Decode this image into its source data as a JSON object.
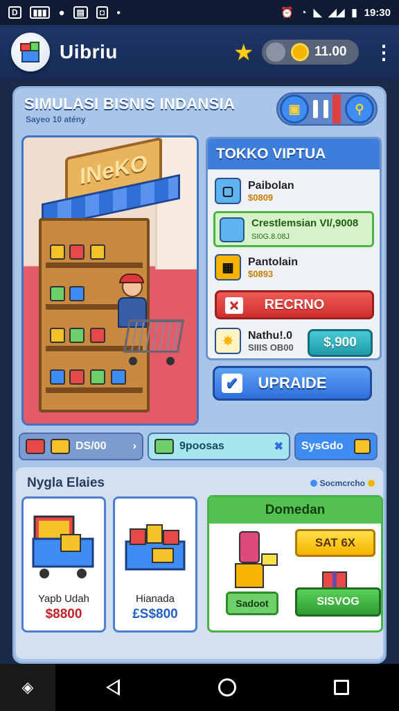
{
  "status_bar": {
    "time": "19:30"
  },
  "app_bar": {
    "title": "Uibriu",
    "coins": "11.00"
  },
  "game": {
    "title": "SIMULASI BISNIS INDANSIA",
    "subtitle": "Sayeo 10 atény",
    "shop_sign": "INeKO"
  },
  "store_panel": {
    "title": "TOKKO VIPTUA",
    "items": [
      {
        "name": "Paibolan",
        "price": "$0809"
      },
      {
        "name": "Crestlemsian",
        "extra": "VI/,9008",
        "sub": "SI0G.8.08J"
      },
      {
        "name": "Pantolain",
        "price": "$0893"
      }
    ],
    "red_button": "RECRNO",
    "nathul": {
      "name": "Nathu!.0",
      "sub": "SIIIS OB00",
      "button": "$,900"
    },
    "upgrade_button": "UPRAIDE"
  },
  "stats": {
    "left": "DS/00",
    "middle": "9poosas",
    "right": "SysGdo"
  },
  "section": {
    "title": "Nygla Elaies",
    "right_label": "Socmcrcho",
    "cards": [
      {
        "name": "Yapb Udah",
        "price": "$8800",
        "color": "#c0202a"
      },
      {
        "name": "Hianada",
        "price": "£S$800",
        "color": "#1f5fc2"
      }
    ],
    "dom": {
      "title": "Domedan",
      "yellow_button": "SAT 6X",
      "small_button": "Sadoot",
      "green_button": "SISVOG"
    }
  },
  "colors": {
    "accent": "#3e7dda",
    "bg": "#a9c6e8"
  }
}
